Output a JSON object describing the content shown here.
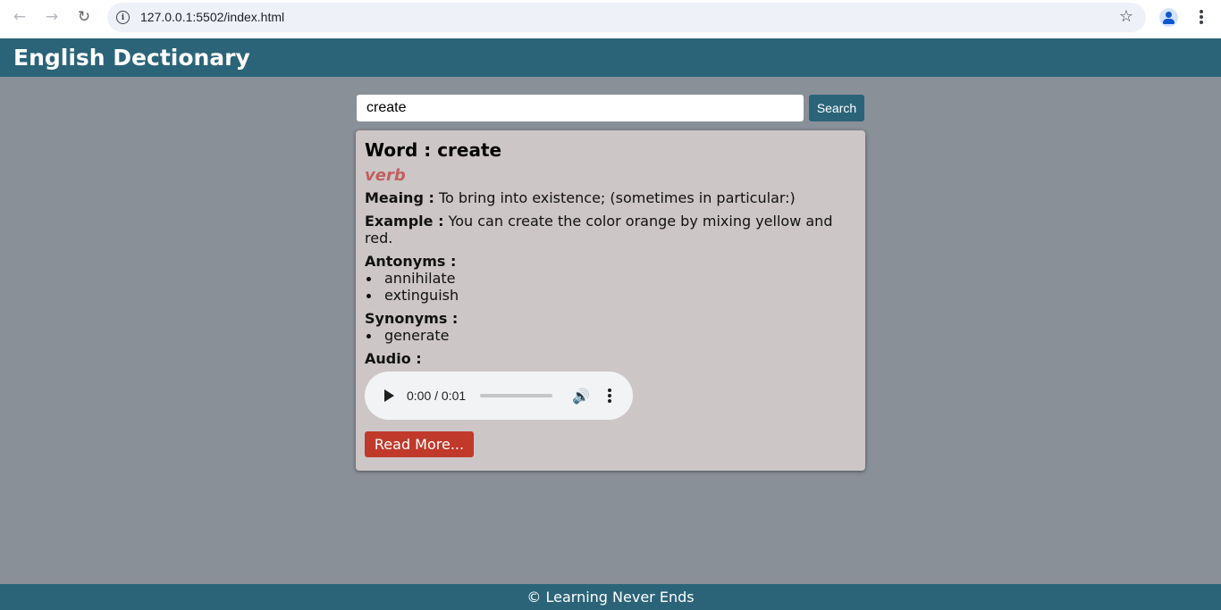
{
  "browser": {
    "url": "127.0.0.1:5502/index.html"
  },
  "header": {
    "title": "English Dectionary"
  },
  "search": {
    "value": "create",
    "button_label": "Search"
  },
  "result": {
    "word_label": "Word : create",
    "part_of_speech": "verb",
    "meaning_label": "Meaing :",
    "meaning": "To bring into existence; (sometimes in particular:)",
    "example_label": "Example :",
    "example": "You can create the color orange by mixing yellow and red.",
    "antonyms_label": "Antonyms :",
    "antonyms": [
      "annihilate",
      "extinguish"
    ],
    "synonyms_label": "Synonyms :",
    "synonyms": [
      "generate"
    ],
    "audio_label": "Audio :",
    "audio_time": "0:00 / 0:01",
    "read_more_label": "Read More..."
  },
  "footer": {
    "text": "© Learning Never Ends"
  },
  "colors": {
    "header_bg": "#2b6479",
    "page_bg": "#8a9098",
    "card_bg": "#cdc6c6",
    "pos_color": "#c0605e",
    "read_more_bg": "#c0392b"
  }
}
